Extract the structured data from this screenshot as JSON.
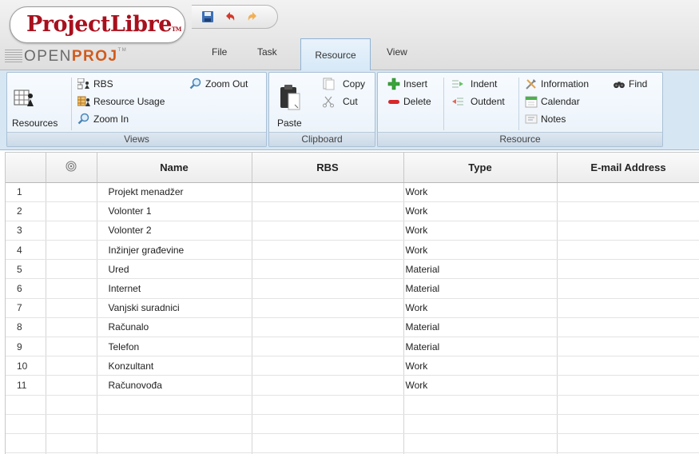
{
  "app": {
    "logo_main": "ProjectLibre",
    "logo_tm": "TM",
    "logo_sub_a": "OPEN",
    "logo_sub_b": "PROJ",
    "logo_sub_tm": "TM"
  },
  "quick_access": {
    "icons": [
      "save-icon",
      "undo-icon",
      "redo-icon"
    ]
  },
  "tabs": [
    {
      "label": "File",
      "active": false
    },
    {
      "label": "Task",
      "active": false
    },
    {
      "label": "Resource",
      "active": true
    },
    {
      "label": "View",
      "active": false
    }
  ],
  "ribbon": {
    "views": {
      "group_label": "Views",
      "resources_label": "Resources",
      "rbs_label": "RBS",
      "resource_usage_label": "Resource Usage",
      "zoom_in_label": "Zoom In",
      "zoom_out_label": "Zoom Out"
    },
    "clipboard": {
      "group_label": "Clipboard",
      "paste_label": "Paste",
      "copy_label": "Copy",
      "cut_label": "Cut"
    },
    "resource": {
      "group_label": "Resource",
      "insert_label": "Insert",
      "delete_label": "Delete",
      "indent_label": "Indent",
      "outdent_label": "Outdent",
      "information_label": "Information",
      "find_label": "Find",
      "calendar_label": "Calendar",
      "notes_label": "Notes"
    }
  },
  "grid": {
    "columns": [
      "",
      "",
      "Name",
      "RBS",
      "Type",
      "E-mail Address"
    ],
    "rows": [
      {
        "num": "1",
        "name": "Projekt menadžer",
        "rbs": "",
        "type": "Work",
        "email": ""
      },
      {
        "num": "2",
        "name": "Volonter 1",
        "rbs": "",
        "type": "Work",
        "email": ""
      },
      {
        "num": "3",
        "name": "Volonter 2",
        "rbs": "",
        "type": "Work",
        "email": ""
      },
      {
        "num": "4",
        "name": "Inžinjer građevine",
        "rbs": "",
        "type": "Work",
        "email": ""
      },
      {
        "num": "5",
        "name": "Ured",
        "rbs": "",
        "type": "Material",
        "email": ""
      },
      {
        "num": "6",
        "name": "Internet",
        "rbs": "",
        "type": "Material",
        "email": ""
      },
      {
        "num": "7",
        "name": "Vanjski suradnici",
        "rbs": "",
        "type": "Work",
        "email": ""
      },
      {
        "num": "8",
        "name": "Računalo",
        "rbs": "",
        "type": "Material",
        "email": ""
      },
      {
        "num": "9",
        "name": "Telefon",
        "rbs": "",
        "type": "Material",
        "email": ""
      },
      {
        "num": "10",
        "name": "Konzultant",
        "rbs": "",
        "type": "Work",
        "email": ""
      },
      {
        "num": "11",
        "name": "Računovođa",
        "rbs": "",
        "type": "Work",
        "email": ""
      },
      {
        "num": "",
        "name": "",
        "rbs": "",
        "type": "",
        "email": ""
      },
      {
        "num": "",
        "name": "",
        "rbs": "",
        "type": "",
        "email": ""
      },
      {
        "num": "",
        "name": "",
        "rbs": "",
        "type": "",
        "email": ""
      },
      {
        "num": "",
        "name": "",
        "rbs": "",
        "type": "",
        "email": ""
      }
    ]
  }
}
